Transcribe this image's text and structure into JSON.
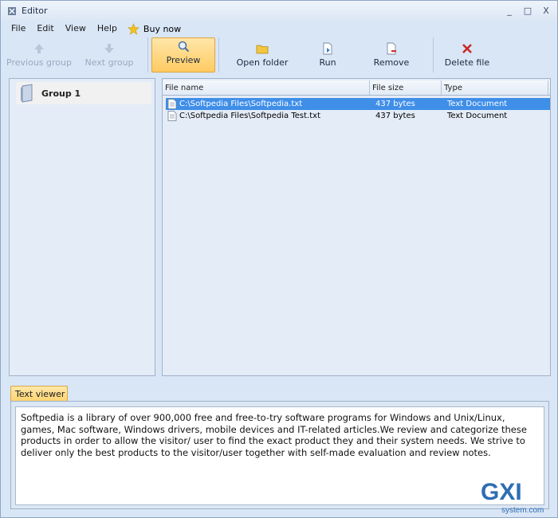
{
  "window": {
    "title": "Editor",
    "minimize": "_",
    "maximize": "□",
    "close": "X"
  },
  "menu": {
    "items": [
      "File",
      "Edit",
      "View",
      "Help"
    ],
    "buy_now": "Buy now"
  },
  "toolbar": {
    "previous_group": "Previous group",
    "next_group": "Next group",
    "preview": "Preview",
    "open_folder": "Open folder",
    "run": "Run",
    "remove": "Remove",
    "delete_file": "Delete file"
  },
  "groups": [
    {
      "label": "Group 1"
    }
  ],
  "file_list": {
    "columns": [
      "File name",
      "File size",
      "Type"
    ],
    "rows": [
      {
        "name": "C:\\Softpedia Files\\Softpedia.txt",
        "size": "437 bytes",
        "type": "Text Document",
        "selected": true
      },
      {
        "name": "C:\\Softpedia Files\\Softpedia Test.txt",
        "size": "437 bytes",
        "type": "Text Document",
        "selected": false
      }
    ]
  },
  "text_viewer": {
    "tab_label": "Text viewer",
    "content": "Softpedia is a library of over 900,000 free and free-to-try software programs for Windows and Unix/Linux, games, Mac software, Windows drivers, mobile devices and IT-related articles.We review and categorize these products in order to allow the visitor/ user to find the exact product they and their system needs. We strive to deliver only the best products to the visitor/user together with self-made evaluation and review notes."
  },
  "colors": {
    "accent": "#3f8ee8",
    "active_button": "#ffcb63",
    "background": "#d9e6f6"
  },
  "watermark": {
    "text": "GXI",
    "subtext": "system.com"
  }
}
